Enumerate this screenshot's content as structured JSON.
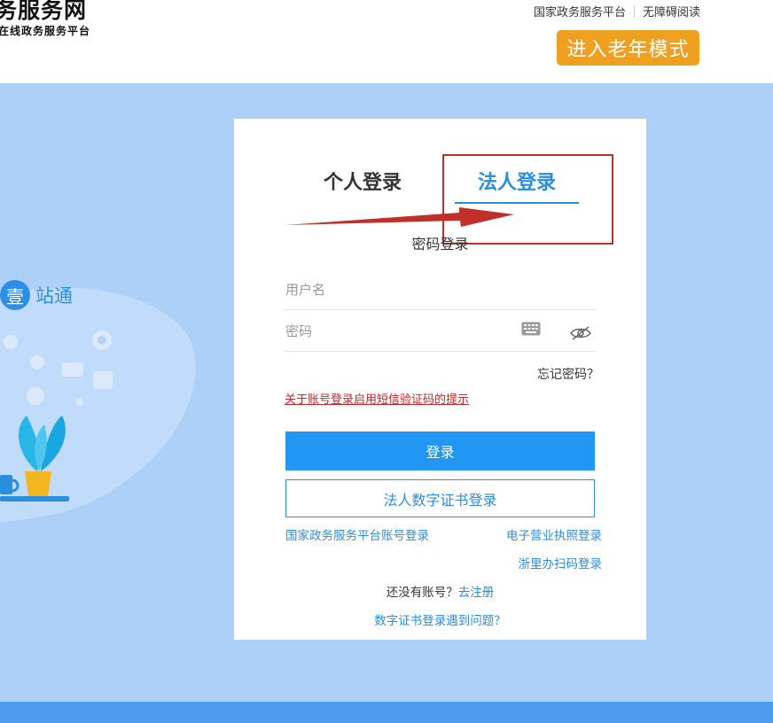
{
  "header": {
    "title": "务服务网",
    "subtitle": "在线政务服务平台",
    "top_links": [
      "国家政务服务平台",
      "无障碍阅读"
    ],
    "elder_mode_label": "进入老年模式"
  },
  "brand": {
    "badge_char": "壹",
    "name": "站通"
  },
  "login": {
    "tabs": [
      {
        "label": "个人登录",
        "active": false
      },
      {
        "label": "法人登录",
        "active": true
      }
    ],
    "mode_label": "密码登录",
    "username_placeholder": "用户名",
    "password_placeholder": "密码",
    "forgot_label": "忘记密码？",
    "sms_notice": "关于账号登录启用短信验证码的提示",
    "login_button": "登录",
    "cert_login_button": "法人数字证书登录",
    "national_link": "国家政务服务平台账号登录",
    "e_license_link": "电子营业执照登录",
    "zlb_link": "浙里办扫码登录",
    "no_account_text": "还没有账号？",
    "register_link": "去注册",
    "cert_problem_link": "数字证书登录遇到问题？"
  },
  "colors": {
    "primary": "#2196f3",
    "accent_orange": "#f0a020",
    "background_band": "#acd0f8",
    "highlight_red": "#c0302a"
  },
  "icons": [
    "keyboard-icon",
    "eye-off-icon",
    "arrow-annotation"
  ]
}
